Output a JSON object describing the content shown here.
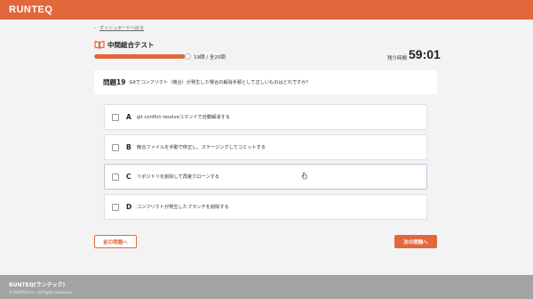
{
  "header": {
    "logo": "RUNTEQ",
    "brand_color": "#e2683c"
  },
  "nav": {
    "back_link": "ダッシュボードへ戻る",
    "back_icon": "chevron-left-icon"
  },
  "exam": {
    "title": "中間総合テスト",
    "title_icon": "book-icon",
    "progress_text": "19問 / 全20問",
    "progress_fraction": 0.95,
    "timer_label": "残り時間",
    "timer_value": "59:01"
  },
  "question": {
    "number": "問題19",
    "text": "Gitでコンフリクト（競合）が発生した場合の解消手順として正しいものはどれですか？"
  },
  "options": [
    {
      "letter": "A",
      "text": "git conflict resolveコマンドで自動解消する"
    },
    {
      "letter": "B",
      "text": "競合ファイルを手動で修正し、ステージングしてコミットする"
    },
    {
      "letter": "C",
      "text": "リポジトリを削除して再度クローンする"
    },
    {
      "letter": "D",
      "text": "コンフリクトが発生したブランチを削除する"
    }
  ],
  "buttons": {
    "prev": "前の問題へ",
    "next": "次の問題へ"
  },
  "footer": {
    "brand": "RUNTEQ(ランテック)",
    "copyright": "© RUNTEQ Inc. All Rights Reserved."
  }
}
